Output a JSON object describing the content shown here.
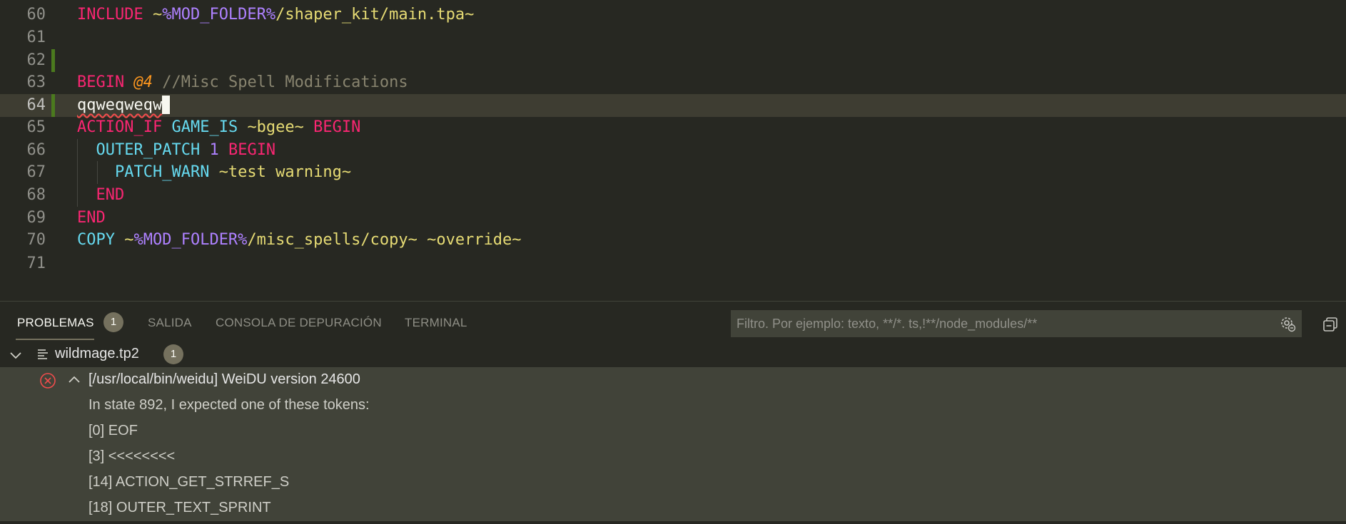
{
  "editor": {
    "lines": [
      {
        "num": "60",
        "tokens": [
          {
            "c": "kw",
            "t": "INCLUDE"
          },
          {
            "c": "",
            "t": " "
          },
          {
            "c": "str",
            "t": "~"
          },
          {
            "c": "var",
            "t": "%MOD_FOLDER%"
          },
          {
            "c": "str",
            "t": "/shaper_kit/main.tpa~"
          }
        ]
      },
      {
        "num": "61",
        "tokens": []
      },
      {
        "num": "62",
        "tokens": []
      },
      {
        "num": "63",
        "tokens": [
          {
            "c": "kw",
            "t": "BEGIN"
          },
          {
            "c": "",
            "t": " "
          },
          {
            "c": "at",
            "t": "@4"
          },
          {
            "c": "",
            "t": " "
          },
          {
            "c": "cm",
            "t": "//Misc Spell Modifications"
          }
        ]
      },
      {
        "num": "64",
        "tokens": [
          {
            "c": "squiggle",
            "t": "qqweqweqw"
          }
        ]
      },
      {
        "num": "65",
        "tokens": [
          {
            "c": "kw",
            "t": "ACTION_IF"
          },
          {
            "c": "",
            "t": " "
          },
          {
            "c": "fn",
            "t": "GAME_IS"
          },
          {
            "c": "",
            "t": " "
          },
          {
            "c": "str",
            "t": "~bgee~"
          },
          {
            "c": "",
            "t": " "
          },
          {
            "c": "kw",
            "t": "BEGIN"
          }
        ]
      },
      {
        "num": "66",
        "tokens": [
          {
            "c": "",
            "t": "  "
          },
          {
            "c": "fn",
            "t": "OUTER_PATCH"
          },
          {
            "c": "",
            "t": " "
          },
          {
            "c": "num",
            "t": "1"
          },
          {
            "c": "",
            "t": " "
          },
          {
            "c": "kw",
            "t": "BEGIN"
          }
        ]
      },
      {
        "num": "67",
        "tokens": [
          {
            "c": "",
            "t": "    "
          },
          {
            "c": "fn",
            "t": "PATCH_WARN"
          },
          {
            "c": "",
            "t": " "
          },
          {
            "c": "str",
            "t": "~test warning~"
          }
        ]
      },
      {
        "num": "68",
        "tokens": [
          {
            "c": "",
            "t": "  "
          },
          {
            "c": "kw",
            "t": "END"
          }
        ]
      },
      {
        "num": "69",
        "tokens": [
          {
            "c": "kw",
            "t": "END"
          }
        ]
      },
      {
        "num": "70",
        "tokens": [
          {
            "c": "fn",
            "t": "COPY"
          },
          {
            "c": "",
            "t": " "
          },
          {
            "c": "str",
            "t": "~"
          },
          {
            "c": "var",
            "t": "%MOD_FOLDER%"
          },
          {
            "c": "str",
            "t": "/misc_spells/copy~ ~override~"
          }
        ]
      },
      {
        "num": "71",
        "tokens": []
      }
    ]
  },
  "panel": {
    "tabs": [
      {
        "label": "PROBLEMAS",
        "badge": "1"
      },
      {
        "label": "SALIDA"
      },
      {
        "label": "CONSOLA DE DEPURACIÓN"
      },
      {
        "label": "TERMINAL"
      }
    ],
    "filter_placeholder": "Filtro. Por ejemplo: texto, **/*. ts,!**/node_modules/**",
    "file": {
      "name": "wildmage.tp2",
      "count": "1"
    },
    "problem": {
      "header": "[/usr/local/bin/weidu] WeiDU version 24600",
      "details": [
        "In state 892, I expected one of these tokens:",
        "[0] EOF",
        "[3] <<<<<<<<",
        "[14] ACTION_GET_STRREF_S",
        "[18] OUTER_TEXT_SPRINT"
      ]
    }
  },
  "colors": {
    "error": "#f14c4c",
    "accent": "#75715e",
    "background": "#272822"
  },
  "icons": [
    "chevron-down-icon",
    "file-lines-icon",
    "error-circle-icon",
    "chevron-up-icon",
    "filter-settings-icon",
    "collapse-all-icon"
  ]
}
